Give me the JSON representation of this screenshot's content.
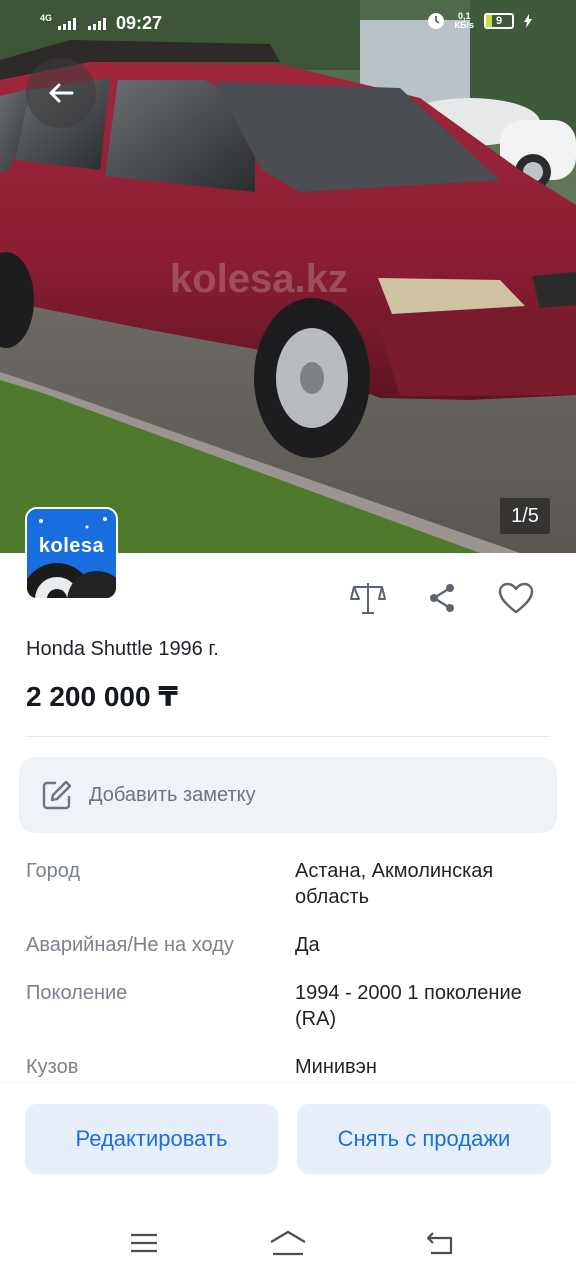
{
  "status_bar": {
    "network": "4G",
    "time": "09:27",
    "speed_value": "0,1",
    "speed_unit": "КБ/s",
    "battery": "9"
  },
  "gallery": {
    "watermark": "kolesa.kz",
    "counter": "1/5"
  },
  "seller_logo": {
    "text": "kolesa"
  },
  "listing": {
    "title": "Honda Shuttle 1996 г.",
    "price": "2 200 000 ₸"
  },
  "note": {
    "label": "Добавить заметку"
  },
  "specs": [
    {
      "key": "Город",
      "value": "Астана, Акмолинская область"
    },
    {
      "key": "Аварийная/Не на ходу",
      "value": "Да"
    },
    {
      "key": "Поколение",
      "value": "1994 - 2000 1 поколение (RA)"
    },
    {
      "key": "Кузов",
      "value": "Минивэн"
    }
  ],
  "bottom_actions": {
    "edit_label": "Редактировать",
    "unpublish_label": "Снять с продажи"
  },
  "icons": {
    "back": "arrow-left-icon",
    "compare": "compare-icon",
    "share": "share-icon",
    "favorite": "heart-icon",
    "note": "edit-note-icon",
    "menu": "menu-icon",
    "home": "home-icon",
    "back_nav": "back-icon"
  },
  "colors": {
    "accent": "#1b6fd9",
    "button_bg": "#e6eef9",
    "note_bg": "#eff3f8",
    "car_red": "#8e1e33",
    "logo_blue": "#1a6fe0"
  }
}
